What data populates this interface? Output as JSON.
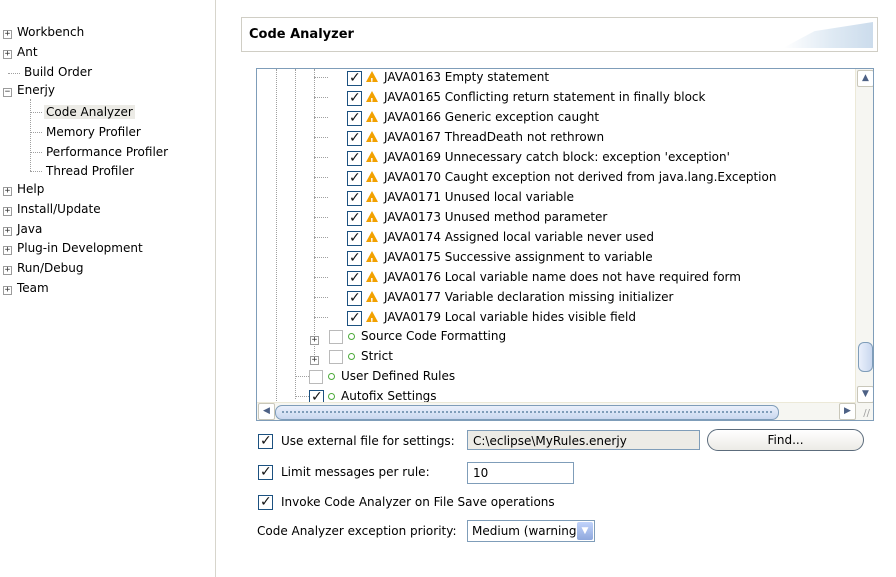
{
  "nav": {
    "items": [
      {
        "label": "Workbench"
      },
      {
        "label": "Ant"
      },
      {
        "label": "Build Order"
      },
      {
        "label": "Enerjy"
      },
      {
        "label": "Code Analyzer"
      },
      {
        "label": "Memory Profiler"
      },
      {
        "label": "Performance Profiler"
      },
      {
        "label": "Thread Profiler"
      },
      {
        "label": "Help"
      },
      {
        "label": "Install/Update"
      },
      {
        "label": "Java"
      },
      {
        "label": "Plug-in Development"
      },
      {
        "label": "Run/Debug"
      },
      {
        "label": "Team"
      }
    ]
  },
  "page": {
    "title": "Code Analyzer"
  },
  "rules": {
    "items": [
      {
        "text": "JAVA0163 Empty statement"
      },
      {
        "text": "JAVA0165 Conflicting return statement in finally block"
      },
      {
        "text": "JAVA0166 Generic exception caught"
      },
      {
        "text": "JAVA0167 ThreadDeath not rethrown"
      },
      {
        "text": "JAVA0169 Unnecessary catch block: exception 'exception'"
      },
      {
        "text": "JAVA0170 Caught exception not derived from java.lang.Exception"
      },
      {
        "text": "JAVA0171 Unused local variable"
      },
      {
        "text": "JAVA0173 Unused method parameter"
      },
      {
        "text": "JAVA0174 Assigned local variable never used"
      },
      {
        "text": "JAVA0175 Successive assignment to variable"
      },
      {
        "text": "JAVA0176 Local variable name does not have required form"
      },
      {
        "text": "JAVA0177 Variable declaration missing initializer"
      },
      {
        "text": "JAVA0179 Local variable hides visible field"
      }
    ],
    "groups": [
      {
        "label": "Source Code Formatting"
      },
      {
        "label": "Strict"
      },
      {
        "label": "User Defined Rules"
      },
      {
        "label": "Autofix Settings"
      }
    ]
  },
  "options": {
    "external_file_label": "Use external file for settings:",
    "external_file_value": "C:\\eclipse\\MyRules.enerjy",
    "find_button": "Find...",
    "limit_label": "Limit messages per rule:",
    "limit_value": "10",
    "invoke_label": "Invoke Code Analyzer on File Save operations",
    "priority_label": "Code Analyzer exception priority:",
    "priority_value": "Medium (warning)"
  },
  "colors": {
    "warning": "#f2a100",
    "checkmark": "#111111",
    "group_dot": "#4caa3a",
    "border": "#7f9db9"
  }
}
